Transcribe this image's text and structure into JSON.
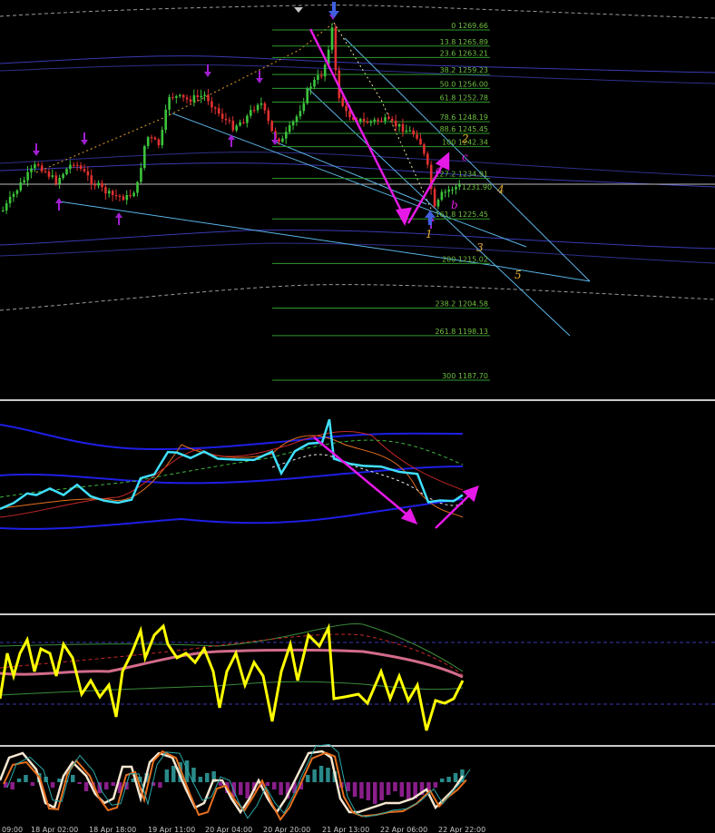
{
  "chart_data": {
    "type": "candlestick",
    "fib_levels": [
      {
        "pct": "0",
        "price": "1269.66"
      },
      {
        "pct": "13.8",
        "price": "1265.89"
      },
      {
        "pct": "23.6",
        "price": "1263.21"
      },
      {
        "pct": "38.2",
        "price": "1259.23"
      },
      {
        "pct": "50.0",
        "price": "1256.00"
      },
      {
        "pct": "61.8",
        "price": "1252.78"
      },
      {
        "pct": "78.6",
        "price": "1248.19"
      },
      {
        "pct": "88.6",
        "price": "1245.45"
      },
      {
        "pct": "100",
        "price": "1242.34"
      },
      {
        "pct": "127.2",
        "price": "1234.91"
      },
      {
        "pct": "161.8",
        "price": "1225.45"
      },
      {
        "pct": "200",
        "price": "1215.02"
      },
      {
        "pct": "238.2",
        "price": "1204.58"
      },
      {
        "pct": "261.8",
        "price": "1198.13"
      },
      {
        "pct": "300",
        "price": "1187.70"
      }
    ],
    "current_price_label": "1231.90",
    "wave_labels": {
      "orange": [
        "1",
        "2",
        "3",
        "4",
        "5"
      ],
      "magenta": [
        "a",
        "b",
        "c"
      ]
    },
    "time_labels": [
      "09:00",
      "18 Apr 02:00",
      "18 Apr 18:00",
      "19 Apr 11:00",
      "20 Apr 04:00",
      "20 Apr 20:00",
      "21 Apr 13:00",
      "22 Apr 06:00",
      "22 Apr 22:00"
    ],
    "colors": {
      "bull": "#3cc43c",
      "bear": "#e03030",
      "fib": "#2f9a2f",
      "channel": "#5ab4e6",
      "magenta": "#e619e6",
      "wave": "#e6b030",
      "bands": "#3a3ab4",
      "rsi": "#ffff00",
      "osc_line": "#40e0ff"
    }
  }
}
